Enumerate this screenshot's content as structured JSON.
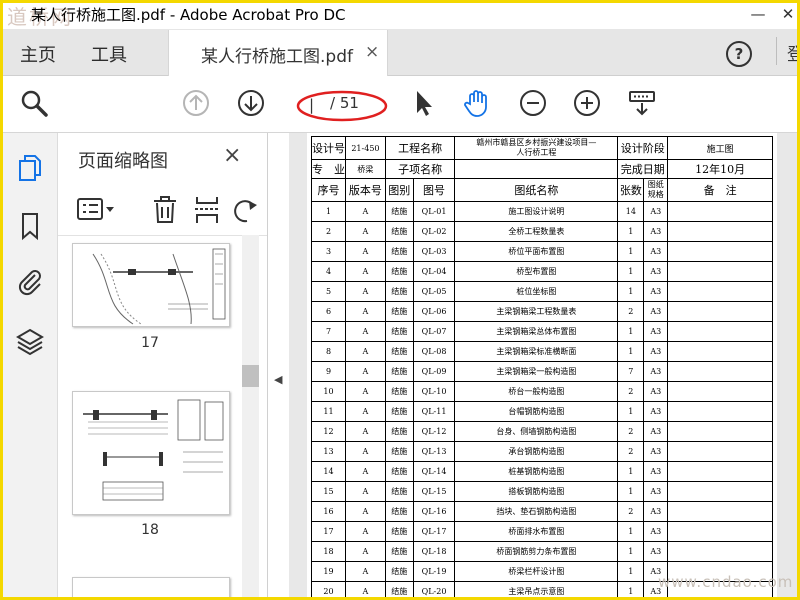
{
  "window": {
    "title": "某人行桥施工图.pdf - Adobe Acrobat Pro DC",
    "watermark": "道桥网",
    "bottom_watermark": "www.cndao.com"
  },
  "menu": {
    "home": "主页",
    "tools": "工具",
    "doc_tab": "某人行桥施工图.pdf",
    "tab_close": "×",
    "help": "?",
    "login": "登"
  },
  "toolbar": {
    "page_input": "|",
    "page_total": "/ 51",
    "icons": [
      "search-icon",
      "page-up-icon",
      "page-down-icon",
      "select-cursor-icon",
      "hand-tool-icon",
      "zoom-out-icon",
      "zoom-in-icon",
      "scroll-mode-icon"
    ]
  },
  "thumbnails": {
    "title": "页面缩略图",
    "close": "×",
    "pages": [
      {
        "number": "17"
      },
      {
        "number": "18"
      }
    ]
  },
  "drawing": {
    "design_no_label": "设计号",
    "design_no": "21-450",
    "project_name_label": "工程名称",
    "project_name_line1": "赣州市赣县区乡村振兴建设项目—",
    "project_name_line2": "人行桥工程",
    "design_stage_label": "设计阶段",
    "design_stage": "施工图",
    "major_label": "专　业",
    "major": "桥梁",
    "subproject_label": "子项名称",
    "completion_label": "完成日期",
    "completion": "12年10月",
    "col_seq": "序号",
    "col_version": "版本号",
    "col_category": "图别",
    "col_drawing_no": "图号",
    "col_name": "图纸名称",
    "col_sheets": "张数",
    "col_spec": "图纸规格",
    "col_remark": "备　注",
    "rows": [
      {
        "seq": "1",
        "ver": "A",
        "cat": "结施",
        "no": "QL-01",
        "name": "施工图设计说明",
        "sheets": "14",
        "spec": "A3"
      },
      {
        "seq": "2",
        "ver": "A",
        "cat": "结施",
        "no": "QL-02",
        "name": "全桥工程数量表",
        "sheets": "1",
        "spec": "A3"
      },
      {
        "seq": "3",
        "ver": "A",
        "cat": "结施",
        "no": "QL-03",
        "name": "桥位平面布置图",
        "sheets": "1",
        "spec": "A3"
      },
      {
        "seq": "4",
        "ver": "A",
        "cat": "结施",
        "no": "QL-04",
        "name": "桥型布置图",
        "sheets": "1",
        "spec": "A3"
      },
      {
        "seq": "5",
        "ver": "A",
        "cat": "结施",
        "no": "QL-05",
        "name": "桩位坐标图",
        "sheets": "1",
        "spec": "A3"
      },
      {
        "seq": "6",
        "ver": "A",
        "cat": "结施",
        "no": "QL-06",
        "name": "主梁钢箱梁工程数量表",
        "sheets": "2",
        "spec": "A3"
      },
      {
        "seq": "7",
        "ver": "A",
        "cat": "结施",
        "no": "QL-07",
        "name": "主梁钢箱梁总体布置图",
        "sheets": "1",
        "spec": "A3"
      },
      {
        "seq": "8",
        "ver": "A",
        "cat": "结施",
        "no": "QL-08",
        "name": "主梁钢箱梁标准横断面",
        "sheets": "1",
        "spec": "A3"
      },
      {
        "seq": "9",
        "ver": "A",
        "cat": "结施",
        "no": "QL-09",
        "name": "主梁钢箱梁一般构造图",
        "sheets": "7",
        "spec": "A3"
      },
      {
        "seq": "10",
        "ver": "A",
        "cat": "结施",
        "no": "QL-10",
        "name": "桥台一般构造图",
        "sheets": "2",
        "spec": "A3"
      },
      {
        "seq": "11",
        "ver": "A",
        "cat": "结施",
        "no": "QL-11",
        "name": "台帽钢筋构造图",
        "sheets": "1",
        "spec": "A3"
      },
      {
        "seq": "12",
        "ver": "A",
        "cat": "结施",
        "no": "QL-12",
        "name": "台身、侧墙钢筋构造图",
        "sheets": "2",
        "spec": "A3"
      },
      {
        "seq": "13",
        "ver": "A",
        "cat": "结施",
        "no": "QL-13",
        "name": "承台钢筋构造图",
        "sheets": "2",
        "spec": "A3"
      },
      {
        "seq": "14",
        "ver": "A",
        "cat": "结施",
        "no": "QL-14",
        "name": "桩基钢筋构造图",
        "sheets": "1",
        "spec": "A3"
      },
      {
        "seq": "15",
        "ver": "A",
        "cat": "结施",
        "no": "QL-15",
        "name": "搭板钢筋构造图",
        "sheets": "1",
        "spec": "A3"
      },
      {
        "seq": "16",
        "ver": "A",
        "cat": "结施",
        "no": "QL-16",
        "name": "挡块、垫石钢筋构造图",
        "sheets": "2",
        "spec": "A3"
      },
      {
        "seq": "17",
        "ver": "A",
        "cat": "结施",
        "no": "QL-17",
        "name": "桥面排水布置图",
        "sheets": "1",
        "spec": "A3"
      },
      {
        "seq": "18",
        "ver": "A",
        "cat": "结施",
        "no": "QL-18",
        "name": "桥面钢筋剪力条布置图",
        "sheets": "1",
        "spec": "A3"
      },
      {
        "seq": "19",
        "ver": "A",
        "cat": "结施",
        "no": "QL-19",
        "name": "桥梁栏杆设计图",
        "sheets": "1",
        "spec": "A3"
      },
      {
        "seq": "20",
        "ver": "A",
        "cat": "结施",
        "no": "QL-20",
        "name": "主梁吊点示意图",
        "sheets": "1",
        "spec": "A3"
      }
    ]
  }
}
